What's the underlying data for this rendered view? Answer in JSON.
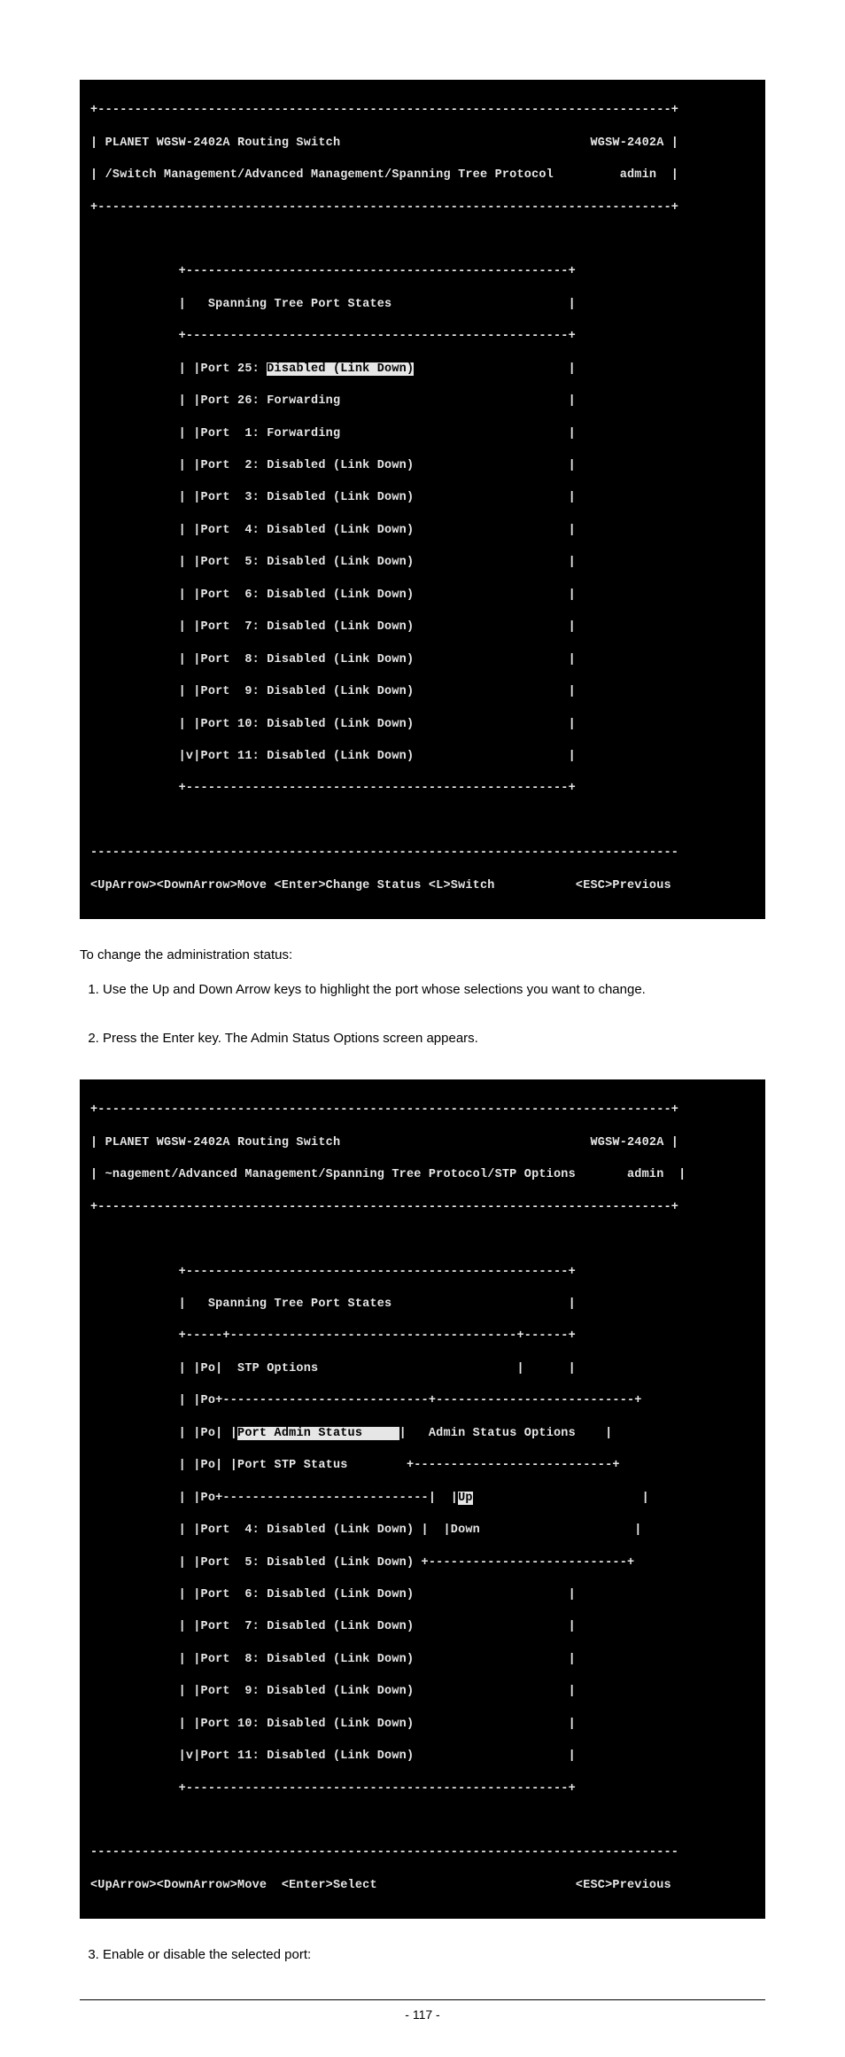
{
  "screenshot1": {
    "top_rule": "+------------------------------------------------------------------------------+",
    "title": "| PLANET WGSW-2402A Routing Switch                                  WGSW-2402A |",
    "breadcrumb": "| /Switch Management/Advanced Management/Spanning Tree Protocol         admin  |",
    "rule2": "+------------------------------------------------------------------------------+",
    "blank1": "                                                                                ",
    "box_top": "            +----------------------------------------------------+",
    "box_title": "            |   Spanning Tree Port States                        |",
    "box_mid": "            +----------------------------------------------------+",
    "r25a": "            | |Port 25: ",
    "r25_hl": "Disabled (Link Down)",
    "r25b": "                     |",
    "r26": "            | |Port 26: Forwarding                               |",
    "r1": "            | |Port  1: Forwarding                               |",
    "r2": "            | |Port  2: Disabled (Link Down)                     |",
    "r3": "            | |Port  3: Disabled (Link Down)                     |",
    "r4": "            | |Port  4: Disabled (Link Down)                     |",
    "r5": "            | |Port  5: Disabled (Link Down)                     |",
    "r6": "            | |Port  6: Disabled (Link Down)                     |",
    "r7": "            | |Port  7: Disabled (Link Down)                     |",
    "r8": "            | |Port  8: Disabled (Link Down)                     |",
    "r9": "            | |Port  9: Disabled (Link Down)                     |",
    "r10": "            | |Port 10: Disabled (Link Down)                     |",
    "r11": "            |v|Port 11: Disabled (Link Down)                     |",
    "box_bot": "            +----------------------------------------------------+",
    "blank2": "                                                                                ",
    "rule3": "--------------------------------------------------------------------------------",
    "footer": "<UpArrow><DownArrow>Move <Enter>Change Status <L>Switch           <ESC>Previous"
  },
  "para_intro": "To change the administration status:",
  "list1": {
    "item1": "Use the Up and Down Arrow keys to highlight the port whose selections you want to change.",
    "item2": "Press the Enter key. The Admin Status Options screen appears."
  },
  "screenshot2": {
    "top_rule": "+------------------------------------------------------------------------------+",
    "title": "| PLANET WGSW-2402A Routing Switch                                  WGSW-2402A |",
    "breadcrumb": "| ~nagement/Advanced Management/Spanning Tree Protocol/STP Options       admin  |",
    "rule2": "+------------------------------------------------------------------------------+",
    "blank1": "                                                                                ",
    "box_top": "            +----------------------------------------------------+",
    "box_title": "            |   Spanning Tree Port States                        |",
    "box_sub": "            +-----+---------------------------------------+------+",
    "stp_hdr": "            | |Po|  STP Options                           |      |",
    "stp_div": "            | |Po+----------------------------+---------------------------+",
    "admin_a": "            | |Po| |",
    "admin_hl": "Port Admin Status     ",
    "admin_b": "|   Admin Status Options    |",
    "stp_stat": "            | |Po| |Port STP Status        +---------------------------+",
    "mid_div_a": "            | |Po+----------------------------|  |",
    "mid_div_hl": "Up",
    "mid_div_b": "                       |",
    "p4": "            | |Port  4: Disabled (Link Down) |  |Down                     |",
    "p5": "            | |Port  5: Disabled (Link Down) +---------------------------+",
    "p6": "            | |Port  6: Disabled (Link Down)                     |",
    "p7": "            | |Port  7: Disabled (Link Down)                     |",
    "p8": "            | |Port  8: Disabled (Link Down)                     |",
    "p9": "            | |Port  9: Disabled (Link Down)                     |",
    "p10": "            | |Port 10: Disabled (Link Down)                     |",
    "p11": "            |v|Port 11: Disabled (Link Down)                     |",
    "box_bot": "            +----------------------------------------------------+",
    "blank2": "                                                                                ",
    "rule3": "--------------------------------------------------------------------------------",
    "footer": "<UpArrow><DownArrow>Move  <Enter>Select                           <ESC>Previous"
  },
  "list2_item3": "Enable or disable the selected port:",
  "page_number": "- 117 -"
}
